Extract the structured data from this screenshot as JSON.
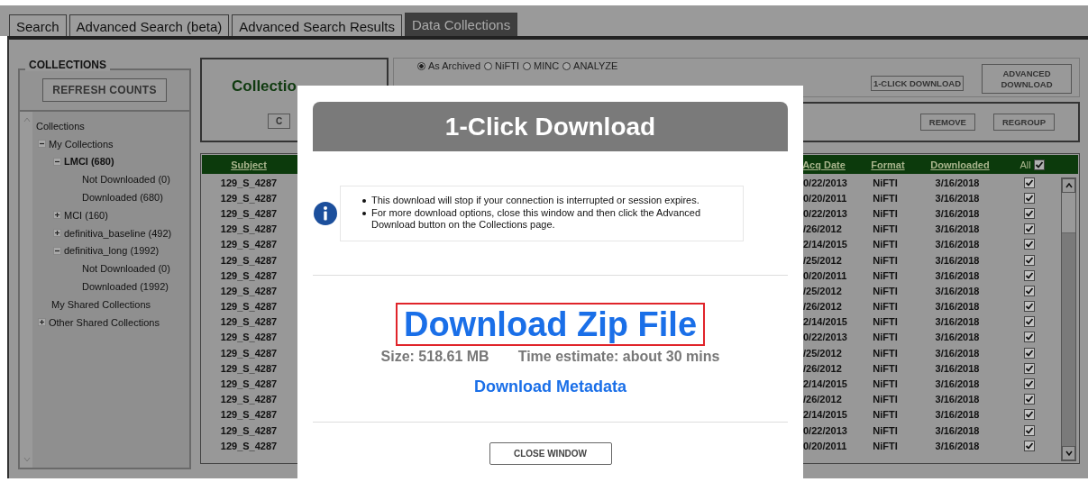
{
  "tabs": [
    {
      "label": "Search",
      "selected": false
    },
    {
      "label": "Advanced Search (beta)",
      "selected": false
    },
    {
      "label": "Advanced Search Results",
      "selected": false
    },
    {
      "label": "Data Collections",
      "selected": true
    }
  ],
  "sidebar": {
    "legend": "COLLECTIONS",
    "refresh_button": "REFRESH COUNTS",
    "tree": [
      {
        "label": "Collections",
        "selected": false,
        "children": [
          {
            "label": "My Collections",
            "selected": false,
            "expanded": true,
            "children": [
              {
                "label": "LMCI (680)",
                "selected": true,
                "expanded": true,
                "children": [
                  {
                    "label": "Not Downloaded (0)",
                    "selected": false
                  },
                  {
                    "label": "Downloaded (680)",
                    "selected": false
                  }
                ]
              },
              {
                "label": "MCI (160)",
                "selected": false,
                "expanded": false
              },
              {
                "label": "definitiva_baseline (492)",
                "selected": false,
                "expanded": false
              },
              {
                "label": "definitiva_long (1992)",
                "selected": false,
                "expanded": true,
                "children": [
                  {
                    "label": "Not Downloaded (0)",
                    "selected": false
                  },
                  {
                    "label": "Downloaded (1992)",
                    "selected": false
                  }
                ]
              }
            ]
          },
          {
            "label": "My Shared Collections",
            "selected": false
          },
          {
            "label": "Other Shared Collections",
            "selected": false,
            "expanded": false
          }
        ]
      }
    ]
  },
  "collection_panel": {
    "title": "Collectio",
    "button": "C"
  },
  "formats": [
    {
      "label": "As Archived",
      "selected": true
    },
    {
      "label": "NiFTI",
      "selected": false
    },
    {
      "label": "MINC",
      "selected": false
    },
    {
      "label": "ANALYZE",
      "selected": false
    }
  ],
  "download_buttons": [
    "1-CLICK DOWNLOAD",
    "ADVANCED DOWNLOAD"
  ],
  "group_buttons": [
    "REMOVE",
    "REGROUP"
  ],
  "table": {
    "columns": [
      "Subject",
      "Acq Date",
      "Format",
      "Downloaded",
      "All"
    ],
    "all_checked": true,
    "rows": [
      {
        "subject": "129_S_4287",
        "acq_date": "0/22/2013",
        "format": "NiFTI",
        "downloaded": "3/16/2018",
        "checked": true
      },
      {
        "subject": "129_S_4287",
        "acq_date": "0/20/2011",
        "format": "NiFTI",
        "downloaded": "3/16/2018",
        "checked": true
      },
      {
        "subject": "129_S_4287",
        "acq_date": "0/22/2013",
        "format": "NiFTI",
        "downloaded": "3/16/2018",
        "checked": true
      },
      {
        "subject": "129_S_4287",
        "acq_date": "/26/2012",
        "format": "NiFTI",
        "downloaded": "3/16/2018",
        "checked": true
      },
      {
        "subject": "129_S_4287",
        "acq_date": "2/14/2015",
        "format": "NiFTI",
        "downloaded": "3/16/2018",
        "checked": true
      },
      {
        "subject": "129_S_4287",
        "acq_date": "/25/2012",
        "format": "NiFTI",
        "downloaded": "3/16/2018",
        "checked": true
      },
      {
        "subject": "129_S_4287",
        "acq_date": "0/20/2011",
        "format": "NiFTI",
        "downloaded": "3/16/2018",
        "checked": true
      },
      {
        "subject": "129_S_4287",
        "acq_date": "/25/2012",
        "format": "NiFTI",
        "downloaded": "3/16/2018",
        "checked": true
      },
      {
        "subject": "129_S_4287",
        "acq_date": "/26/2012",
        "format": "NiFTI",
        "downloaded": "3/16/2018",
        "checked": true
      },
      {
        "subject": "129_S_4287",
        "acq_date": "2/14/2015",
        "format": "NiFTI",
        "downloaded": "3/16/2018",
        "checked": true
      },
      {
        "subject": "129_S_4287",
        "acq_date": "0/22/2013",
        "format": "NiFTI",
        "downloaded": "3/16/2018",
        "checked": true
      },
      {
        "subject": "129_S_4287",
        "acq_date": "/25/2012",
        "format": "NiFTI",
        "downloaded": "3/16/2018",
        "checked": true
      },
      {
        "subject": "129_S_4287",
        "acq_date": "/26/2012",
        "format": "NiFTI",
        "downloaded": "3/16/2018",
        "checked": true
      },
      {
        "subject": "129_S_4287",
        "acq_date": "2/14/2015",
        "format": "NiFTI",
        "downloaded": "3/16/2018",
        "checked": true
      },
      {
        "subject": "129_S_4287",
        "acq_date": "/26/2012",
        "format": "NiFTI",
        "downloaded": "3/16/2018",
        "checked": true
      },
      {
        "subject": "129_S_4287",
        "acq_date": "2/14/2015",
        "format": "NiFTI",
        "downloaded": "3/16/2018",
        "checked": true
      },
      {
        "subject": "129_S_4287",
        "acq_date": "0/22/2013",
        "format": "NiFTI",
        "downloaded": "3/16/2018",
        "checked": true
      },
      {
        "subject": "129_S_4287",
        "acq_date": "0/20/2011",
        "format": "NiFTI",
        "downloaded": "3/16/2018",
        "checked": true
      }
    ]
  },
  "dialog": {
    "title": "1-Click Download",
    "notes": [
      "This download will stop if your connection is interrupted or session expires.",
      "For more download options, close this window and then click the Advanced Download button on the Collections page."
    ],
    "zip_link": "Download Zip File",
    "size": "Size: 518.61 MB",
    "time_estimate": "Time estimate: about 30 mins",
    "metadata_link": "Download Metadata",
    "close_button": "CLOSE WINDOW"
  }
}
